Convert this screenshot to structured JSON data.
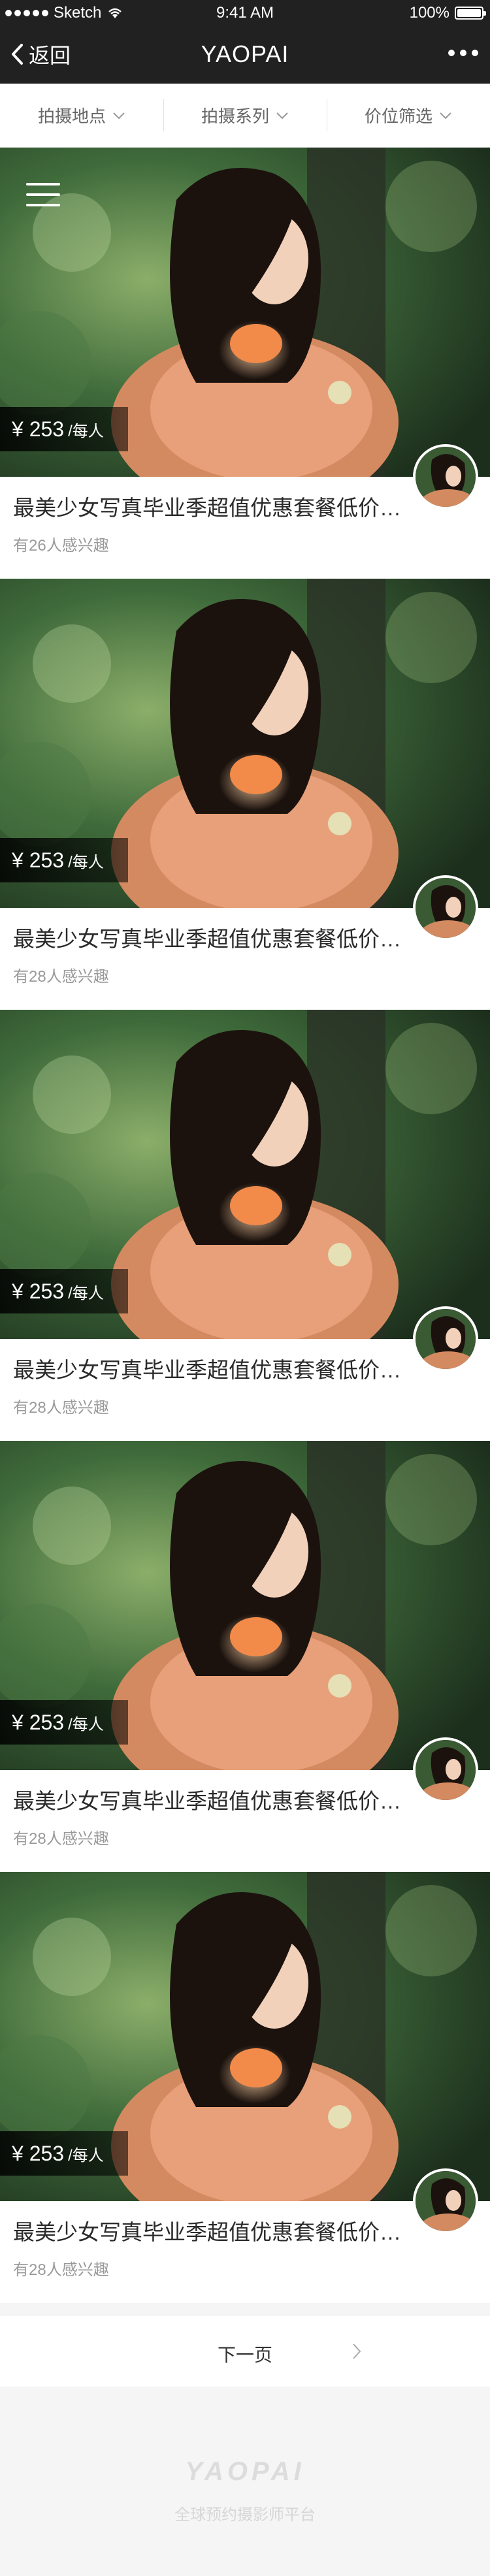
{
  "status_bar": {
    "carrier": "Sketch",
    "time": "9:41 AM",
    "battery": "100%",
    "battery_level": 1.0
  },
  "nav": {
    "back_label": "返回",
    "title": "YAOPAI"
  },
  "filters": [
    {
      "label": "拍摄地点"
    },
    {
      "label": "拍摄系列"
    },
    {
      "label": "价位筛选"
    }
  ],
  "cards": [
    {
      "price": "¥ 253",
      "unit": "/每人",
      "title": "最美少女写真毕业季超值优惠套餐低价抢购",
      "meta": "有26人感兴趣"
    },
    {
      "price": "¥ 253",
      "unit": "/每人",
      "title": "最美少女写真毕业季超值优惠套餐低价抢购",
      "meta": "有28人感兴趣"
    },
    {
      "price": "¥ 253",
      "unit": "/每人",
      "title": "最美少女写真毕业季超值优惠套餐低价抢购",
      "meta": "有28人感兴趣"
    },
    {
      "price": "¥ 253",
      "unit": "/每人",
      "title": "最美少女写真毕业季超值优惠套餐低价抢购",
      "meta": "有28人感兴趣"
    },
    {
      "price": "¥ 253",
      "unit": "/每人",
      "title": "最美少女写真毕业季超值优惠套餐低价抢购",
      "meta": "有28人感兴趣"
    }
  ],
  "pager": {
    "next_label": "下一页"
  },
  "footer": {
    "brand": "YAOPAI",
    "slogan": "全球预约摄影师平台"
  },
  "colors": {
    "nav_bg": "#212121",
    "text_dark": "#2a2a2a",
    "text_muted": "#9a9a9a"
  }
}
